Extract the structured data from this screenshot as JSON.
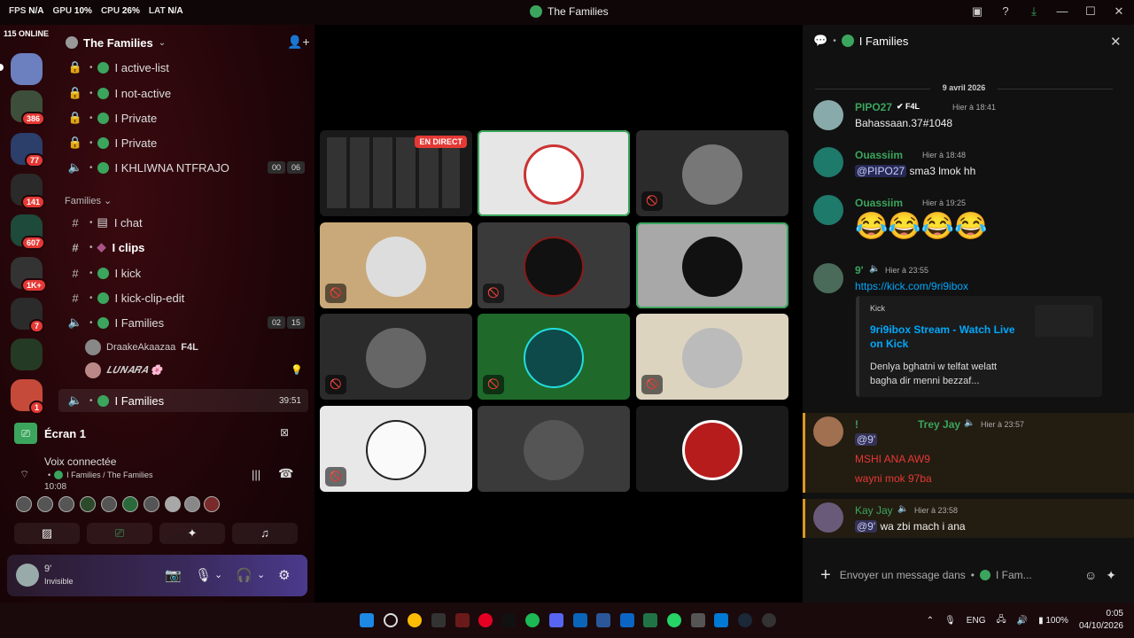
{
  "perf": {
    "fps_label": "FPS",
    "fps": "N/A",
    "gpu_label": "GPU",
    "gpu": "10%",
    "cpu_label": "CPU",
    "cpu": "26%",
    "lat_label": "LAT",
    "lat": "N/A"
  },
  "window": {
    "title": "The Families"
  },
  "rail": {
    "online": "115 ONLINE",
    "badges": [
      "386",
      "77",
      "141",
      "607",
      "1K+",
      "7",
      "1"
    ]
  },
  "server": {
    "name": "The Families"
  },
  "channels_top": [
    {
      "icon": "lock-icon",
      "name": "I active-list"
    },
    {
      "icon": "lock-icon",
      "name": "I not-active"
    },
    {
      "icon": "lock-icon",
      "name": "I Private"
    },
    {
      "icon": "lock-icon",
      "name": "I Private"
    },
    {
      "icon": "speaker-icon",
      "name": "I KHLIWNA NTFRAJO",
      "count_a": "00",
      "count_b": "06"
    }
  ],
  "category": {
    "name": "Families"
  },
  "channels_cat": [
    {
      "name": "I chat"
    },
    {
      "name": "I clips"
    },
    {
      "name": "I kick"
    },
    {
      "name": "I kick-clip-edit"
    },
    {
      "name": "I Families",
      "count_a": "02",
      "count_b": "15"
    }
  ],
  "voice_users": [
    {
      "name": "DraakeAkaazaa",
      "tag": "F4L"
    },
    {
      "name": "𝑳𝑼𝑵𝑨𝑹𝑨 🌸"
    }
  ],
  "active_voice": {
    "name": "I Families",
    "timer": "39:51"
  },
  "screen": {
    "label": "Écran 1"
  },
  "voice_panel": {
    "title": "Voix connectée",
    "subtitle": "I Families / The Families",
    "time": "10:08"
  },
  "user": {
    "name": "9'",
    "status": "Invisible"
  },
  "grid": {
    "live_label": "EN DIRECT"
  },
  "chat": {
    "channel": "I Families",
    "date": "9 avril 2026",
    "messages": [
      {
        "name": "PIPO27",
        "tag": "F4L",
        "time": "Hier à 18:41",
        "text": "Bahassaan.37#1048"
      },
      {
        "name": "Ouassiim",
        "time": "Hier à 18:48",
        "mention": "@PIPO27",
        "text": " sma3 lmok hh"
      },
      {
        "name": "Ouassiim",
        "time": "Hier à 19:25",
        "text": "😂😂😂😂"
      },
      {
        "name": "9'",
        "time": "Hier à 23:55",
        "text": "https://kick.com/9ri9ibox"
      },
      {
        "name": "Trey Jay",
        "prefix": "!",
        "time": "Hier à 23:57",
        "mention": "@9'",
        "text": "MSHI ANA AW9",
        "text2": "wayni mok 97ba"
      },
      {
        "name": "Kay Jay",
        "time": "Hier à 23:58",
        "mention": "@9'",
        "text": " wa zbi mach i ana"
      }
    ],
    "embed": {
      "provider": "Kick",
      "title": "9ri9ibox Stream - Watch Live on Kick",
      "desc": "Denlya bghatni w telfat welatt bagha dir menni bezzaf..."
    },
    "input_placeholder": "Envoyer un message dans",
    "input_channel": "I Fam..."
  },
  "tray": {
    "lang": "ENG",
    "battery": "100%",
    "time": "0:05",
    "date": "04/10/2026"
  },
  "colors": {
    "accent_green": "#3ba55d",
    "danger": "#e53935",
    "link": "#00a8fc"
  }
}
